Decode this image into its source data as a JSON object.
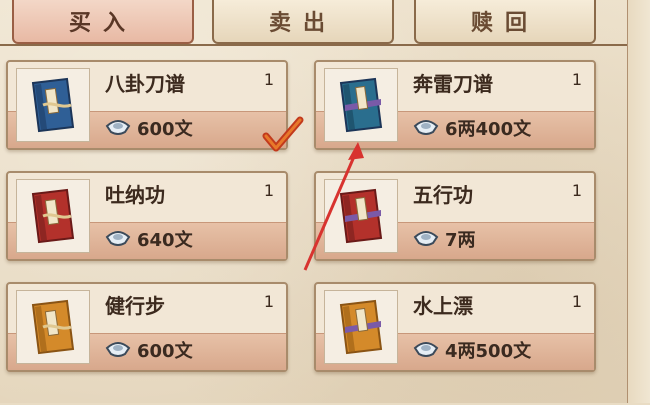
{
  "tabs": [
    {
      "label": "买入",
      "active": true
    },
    {
      "label": "卖出",
      "active": false
    },
    {
      "label": "赎回",
      "active": false
    }
  ],
  "items": [
    {
      "name": "八卦刀谱",
      "qty": "1",
      "price": "600文",
      "book_color": "#2f5f96",
      "selected": true
    },
    {
      "name": "奔雷刀谱",
      "qty": "1",
      "price": "6两400文",
      "book_color": "#2f5f96",
      "selected": false
    },
    {
      "name": "吐纳功",
      "qty": "1",
      "price": "640文",
      "book_color": "#b3312b",
      "selected": false
    },
    {
      "name": "五行功",
      "qty": "1",
      "price": "7两",
      "book_color": "#b3312b",
      "selected": false
    },
    {
      "name": "健行步",
      "qty": "1",
      "price": "600文",
      "book_color": "#d48a2a",
      "selected": false
    },
    {
      "name": "水上漂",
      "qty": "1",
      "price": "4两500文",
      "book_color": "#d48a2a",
      "selected": false
    }
  ],
  "colors": {
    "accent_arrow": "#d8332f",
    "check": "#c23a1c"
  }
}
